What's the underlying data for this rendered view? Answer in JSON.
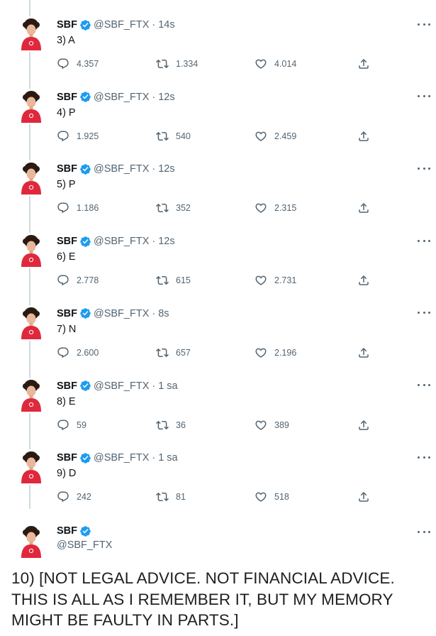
{
  "colors": {
    "verified": "#1d9bf0",
    "text": "#0f1419",
    "muted": "#536471",
    "thread_line": "#cfd9de",
    "avatar_shirt": "#e0283c"
  },
  "icons": {
    "reply": "speech-bubble-icon",
    "retweet": "retweet-arrows-icon",
    "like": "heart-icon",
    "share": "share-upload-icon",
    "verified": "verified-badge-icon",
    "more": "more-dots-icon"
  },
  "tweets": [
    {
      "name": "SBF",
      "handle": "@SBF_FTX",
      "separator": "·",
      "time": "14s",
      "text": "3) A",
      "replies": "4.357",
      "retweets": "1.334",
      "likes": "4.014"
    },
    {
      "name": "SBF",
      "handle": "@SBF_FTX",
      "separator": "·",
      "time": "12s",
      "text": "4) P",
      "replies": "1.925",
      "retweets": "540",
      "likes": "2.459"
    },
    {
      "name": "SBF",
      "handle": "@SBF_FTX",
      "separator": "·",
      "time": "12s",
      "text": "5) P",
      "replies": "1.186",
      "retweets": "352",
      "likes": "2.315"
    },
    {
      "name": "SBF",
      "handle": "@SBF_FTX",
      "separator": "·",
      "time": "12s",
      "text": "6) E",
      "replies": "2.778",
      "retweets": "615",
      "likes": "2.731"
    },
    {
      "name": "SBF",
      "handle": "@SBF_FTX",
      "separator": "·",
      "time": "8s",
      "text": "7) N",
      "replies": "2.600",
      "retweets": "657",
      "likes": "2.196"
    },
    {
      "name": "SBF",
      "handle": "@SBF_FTX",
      "separator": "·",
      "time": "1 sa",
      "text": "8) E",
      "replies": "59",
      "retweets": "36",
      "likes": "389"
    },
    {
      "name": "SBF",
      "handle": "@SBF_FTX",
      "separator": "·",
      "time": "1 sa",
      "text": "9) D",
      "replies": "242",
      "retweets": "81",
      "likes": "518"
    }
  ],
  "final_tweet": {
    "name": "SBF",
    "handle": "@SBF_FTX"
  },
  "caption": "10) [NOT LEGAL ADVICE.  NOT FINANCIAL ADVICE. THIS IS ALL AS I REMEMBER IT, BUT MY MEMORY MIGHT BE FAULTY IN PARTS.]"
}
